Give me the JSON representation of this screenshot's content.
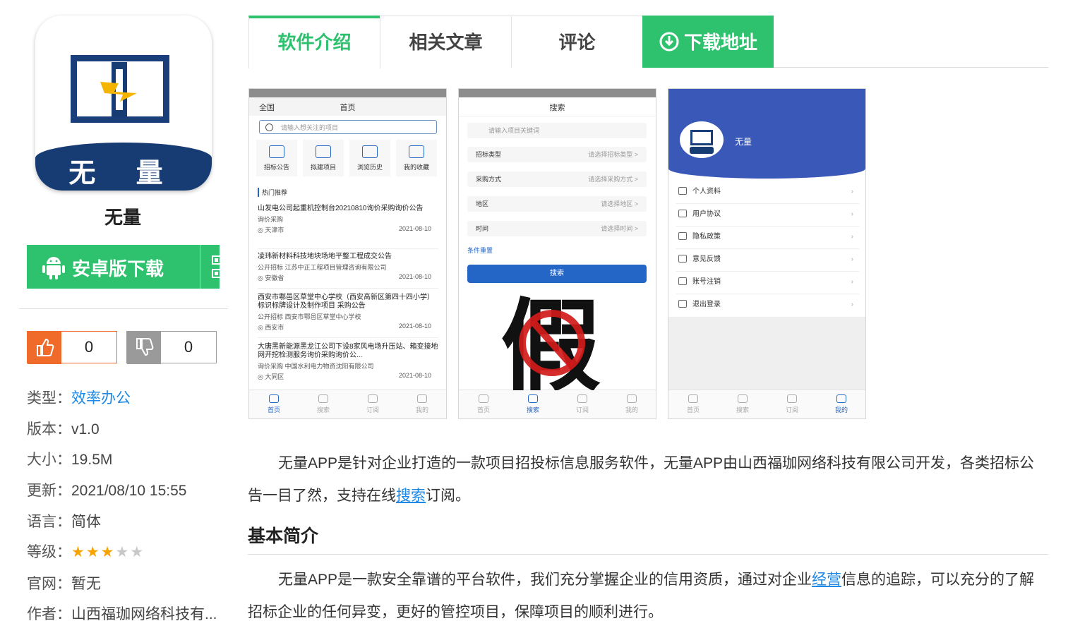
{
  "app": {
    "icon_text": "无 量",
    "name": "无量",
    "download_button": "安卓版下载"
  },
  "votes": {
    "up": "0",
    "down": "0"
  },
  "info": {
    "type_label": "类型：",
    "type_value": "效率办公",
    "version_label": "版本：",
    "version_value": "v1.0",
    "size_label": "大小：",
    "size_value": "19.5M",
    "updated_label": "更新：",
    "updated_value": "2021/08/10 15:55",
    "language_label": "语言：",
    "language_value": "简体",
    "rating_label": "等级：",
    "rating": 3,
    "rating_max": 5,
    "website_label": "官网：",
    "website_value": "暂无",
    "author_label": "作者：",
    "author_value": "山西福珈网络科技有..."
  },
  "tabs": [
    {
      "label": "软件介绍"
    },
    {
      "label": "相关文章"
    },
    {
      "label": "评论"
    },
    {
      "label": "下载地址"
    }
  ],
  "screens": {
    "home": {
      "left": "全国",
      "title": "首页",
      "search_placeholder": "请输入想关注的项目",
      "tiles": [
        "招标公告",
        "拟建项目",
        "浏览历史",
        "我的收藏"
      ],
      "hot": "热门推荐",
      "items": [
        {
          "title": "山发电公司起重机控制台20210810询价采购询价公告",
          "meta": "询价采购",
          "region": "天津市",
          "date": "2021-08-10"
        },
        {
          "title": "凌玮新材料科技地块场地平整工程成交公告",
          "meta": "公开招标   江苏中正工程项目管理咨询有限公司",
          "region": "安徽省",
          "date": "2021-08-10"
        },
        {
          "title": "西安市鄠邑区草堂中心学校（西安高新区第四十四小学）标识标牌设计及制作项目 采购公告",
          "meta": "公开招标   西安市鄠邑区草堂中心学校",
          "region": "西安市",
          "date": "2021-08-10"
        },
        {
          "title": "大唐黑新能源黑龙江公司下设8家风电场升压站、箱变接地网开挖检测服务询价采购询价公...",
          "meta": "询价采购   中国水利电力物资沈阳有限公司",
          "region": "大同区",
          "date": "2021-08-10"
        }
      ],
      "nav": [
        "首页",
        "搜索",
        "订阅",
        "我的"
      ]
    },
    "search": {
      "title": "搜索",
      "keyword_placeholder": "请输入项目关键词",
      "fields": [
        {
          "k": "招标类型",
          "v": "请选择招标类型 >"
        },
        {
          "k": "采购方式",
          "v": "请选择采购方式 >"
        },
        {
          "k": "地区",
          "v": "请选择地区 >"
        },
        {
          "k": "时间",
          "v": "请选择时间 >"
        }
      ],
      "reset": "条件重置",
      "button": "搜索",
      "nav": [
        "首页",
        "搜索",
        "订阅",
        "我的"
      ]
    },
    "profile": {
      "name": "无量",
      "menu": [
        "个人资料",
        "用户协议",
        "隐私政策",
        "意见反馈",
        "账号注销",
        "退出登录"
      ],
      "nav": [
        "首页",
        "搜索",
        "订阅",
        "我的"
      ]
    },
    "watermark": "假"
  },
  "article": {
    "p1_a": "无量APP是针对企业打造的一款项目招投标信息服务软件，无量APP由山西福珈网络科技有限公司开发，各类招标公告一目了然，支持在线",
    "p1_link": "搜索",
    "p1_b": "订阅。",
    "heading": "基本简介",
    "p2_a": "无量APP是一款安全靠谱的平台软件，我们充分掌握企业的信用资质，通过对企业",
    "p2_link": "经营",
    "p2_b": "信息的追踪，可以充分的了解招标企业的任何异变，更好的管控项目，保障项目的顺利进行。"
  },
  "colors": {
    "accent": "#2ec26f",
    "like": "#f06a2a",
    "dislike": "#9a9a9a",
    "link": "#1e88e5",
    "star": "#f5a300",
    "app_blue": "#173b73"
  }
}
